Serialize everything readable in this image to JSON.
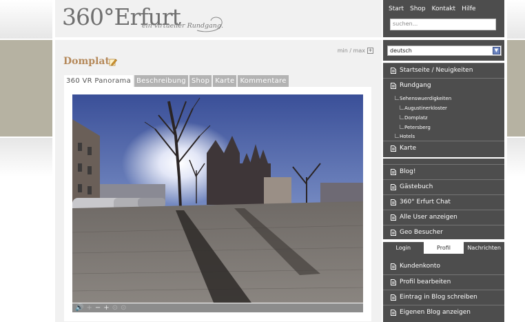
{
  "logo": {
    "main": "360°Erfurt",
    "tagline": "ein virtueller Rundgang."
  },
  "content": {
    "minmax": "min / max",
    "plus_glyph": "+",
    "title": "Domplatz",
    "tabs": [
      {
        "label": "360 VR Panorama",
        "active": true
      },
      {
        "label": "Beschreibung",
        "active": false
      },
      {
        "label": "Shop",
        "active": false
      },
      {
        "label": "Karte",
        "active": false
      },
      {
        "label": "Kommentare",
        "active": false
      }
    ]
  },
  "pano_controls": [
    "🔊",
    "+",
    "−",
    "+",
    "⊙",
    "⊙"
  ],
  "topnav": {
    "links": [
      "Start",
      "Shop",
      "Kontakt",
      "Hilfe"
    ]
  },
  "search": {
    "placeholder": "suchen..."
  },
  "language": {
    "value": "deutsch",
    "arrow": "▼"
  },
  "nav_main": {
    "items": [
      "Startseite / Neuigkeiten",
      "Rundgang",
      "Karte"
    ],
    "sub": [
      "Sehenswuerdigkeiten",
      "Augustinerkloster",
      "Domplatz",
      "Petersberg",
      "Hotels"
    ]
  },
  "nav_community": {
    "items": [
      "Blog!",
      "Gästebuch",
      "360° Erfurt Chat",
      "Alle User anzeigen",
      "Geo Besucher"
    ]
  },
  "user_tabs": [
    {
      "label": "Login",
      "active": false
    },
    {
      "label": "Profil",
      "active": true
    },
    {
      "label": "Nachrichten",
      "active": false
    }
  ],
  "nav_user": {
    "items": [
      "Kundenkonto",
      "Profil bearbeiten",
      "Eintrag in Blog schreiben",
      "Eigenen Blog anzeigen"
    ]
  },
  "colors": {
    "sidebar_bg": "#4d4d4d",
    "title_color": "#b5895a",
    "tab_inactive": "#b3b3b3",
    "band": "#b6b2a2"
  }
}
